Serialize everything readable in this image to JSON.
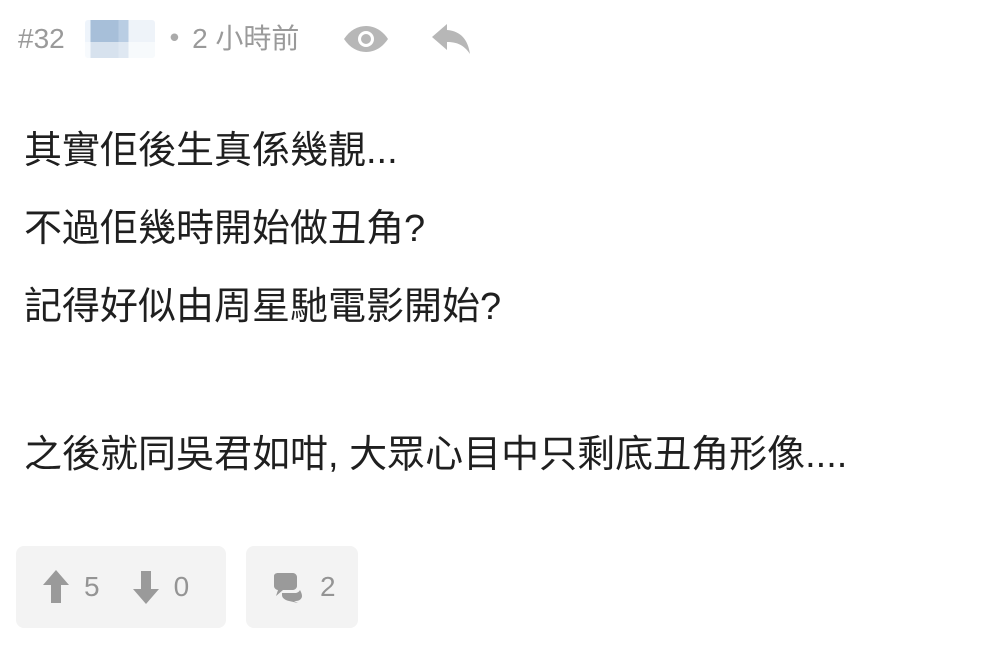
{
  "post": {
    "floor_label": "#32",
    "separator": "•",
    "time_label": "2 小時前",
    "lines": [
      "其實佢後生真係幾靚...",
      "不過佢幾時開始做丑角?",
      "記得好似由周星馳電影開始?",
      "",
      "之後就同吳君如咁, 大眾心目中只剩底丑角形像...."
    ],
    "actions": {
      "upvotes": "5",
      "downvotes": "0",
      "comments": "2"
    }
  },
  "icons": {
    "view": "eye-icon",
    "reply": "reply-icon",
    "upvote": "upvote-icon",
    "downvote": "downvote-icon",
    "comment": "comment-icon"
  },
  "colors": {
    "meta_text": "#9a9a9a",
    "body_text": "#1f1f1f",
    "button_background": "#f3f3f3",
    "icon_gray": "#9a9a9a"
  }
}
